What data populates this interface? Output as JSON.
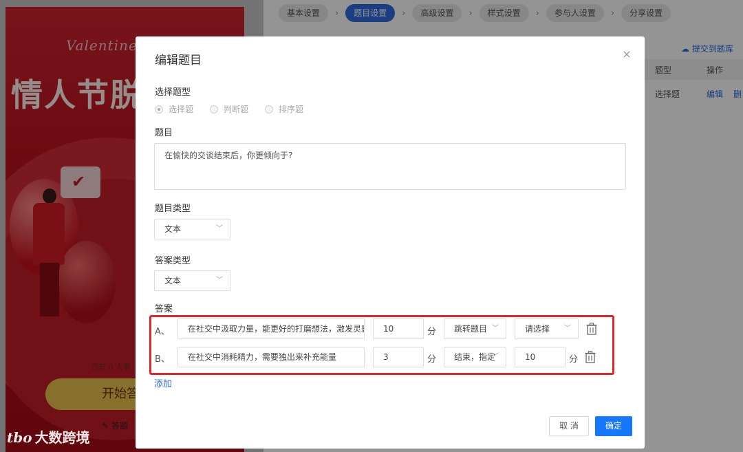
{
  "steps": [
    "基本设置",
    "题目设置",
    "高级设置",
    "样式设置",
    "参与人设置",
    "分享设置"
  ],
  "active_step": "题目设置",
  "poster": {
    "valentine": "Valentine",
    "title": "情人节脱",
    "participants": "已有 0 人参",
    "start_button": "开始答",
    "answer_link": "答题"
  },
  "bg_table": {
    "submit_bank": "提交到题库",
    "col_type": "题型",
    "col_action": "操作",
    "row_type": "选择题",
    "row_edit": "编辑",
    "row_delete": "删"
  },
  "watermark": "大数跨境",
  "watermark_logo": "tbo",
  "modal": {
    "title": "编辑题目",
    "close_symbol": "×",
    "question_type_label": "选择题型",
    "question_types": [
      "选择题",
      "判断题",
      "排序题"
    ],
    "question_label": "题目",
    "question_text": "在愉快的交谈结束后，你更倾向于?",
    "topic_type_label": "题目类型",
    "topic_type_value": "文本",
    "answer_type_label": "答案类型",
    "answer_type_value": "文本",
    "answers_label": "答案",
    "answers": [
      {
        "letter": "A、",
        "text": "在社交中汲取力量，能更好的打磨想法，激发灵感",
        "score": "10",
        "unit": "分",
        "action": "跳转题目",
        "target": "请选择",
        "target_unit": ""
      },
      {
        "letter": "B、",
        "text": "在社交中消耗精力，需要独出来补充能量",
        "score": "3",
        "unit": "分",
        "action": "结束，指定",
        "target": "10",
        "target_unit": "分"
      }
    ],
    "add_label": "添加",
    "cancel_label": "取 消",
    "ok_label": "确定"
  },
  "colors": {
    "accent": "#2d6cdf",
    "primary_button": "#1677ff",
    "highlight_box": "#e0262a"
  }
}
